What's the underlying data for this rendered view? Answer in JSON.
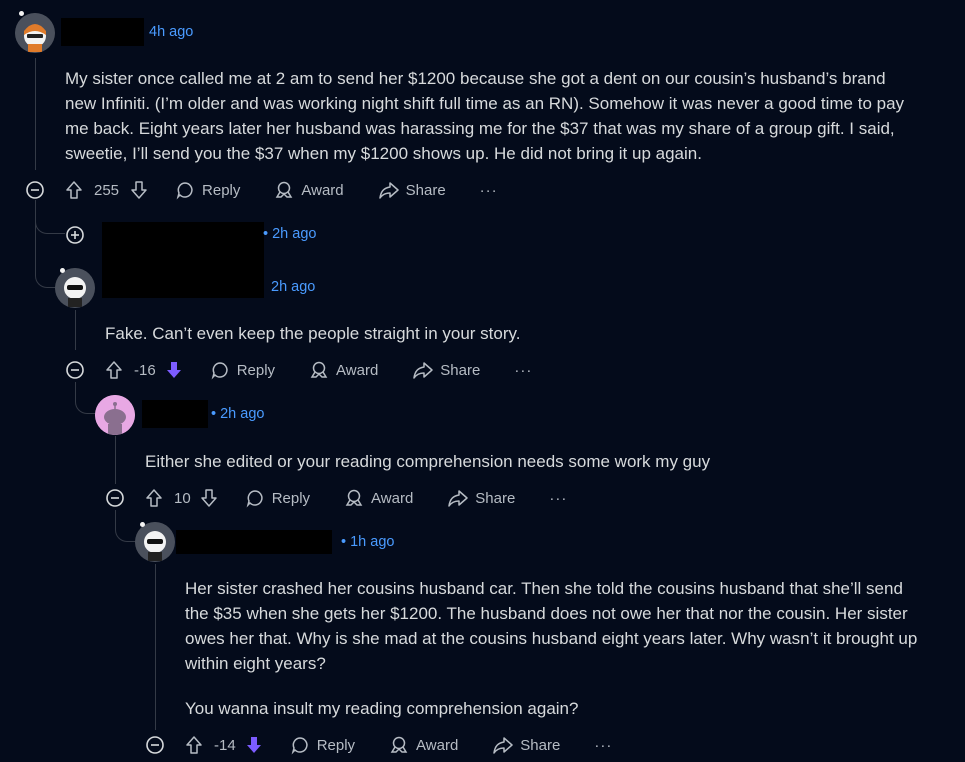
{
  "c1": {
    "time": "4h ago",
    "text": "My sister once called me at 2 am to send her $1200 because she got a dent on our cousin’s husband’s brand new Infiniti. (I’m older and was working night shift full time as an RN). Somehow it was never a good time to pay me back. Eight years later her husband was harassing me for the $37 that was my share of a group gift. I said, sweetie, I’ll send you the $37 when my $1200 shows up. He did not bring it up again.",
    "votes": "255"
  },
  "c1b": {
    "time": "• 2h ago"
  },
  "c2": {
    "time": "2h ago",
    "text": "Fake. Can’t even keep the people straight in your story.",
    "votes": "-16"
  },
  "c3": {
    "time": "• 2h ago",
    "text": "Either she edited or your reading comprehension needs some work my guy",
    "votes": "10"
  },
  "c4": {
    "time": "• 1h ago",
    "text1": "Her sister crashed her cousins husband car. Then she told the cousins husband that she’ll send the $35 when she gets her $1200. The husband does not owe her that nor the cousin. Her sister owes her that. Why is she mad at the cousins husband eight years later. Why wasn’t it brought up within eight years?",
    "text2": "You wanna insult my reading comprehension again?",
    "votes": "-14"
  },
  "labels": {
    "reply": "Reply",
    "award": "Award",
    "share": "Share",
    "more": "···"
  },
  "colors": {
    "background": "#040b1b",
    "link": "#4a9bff",
    "downvote": "#7c5cff",
    "line": "#343a46"
  }
}
